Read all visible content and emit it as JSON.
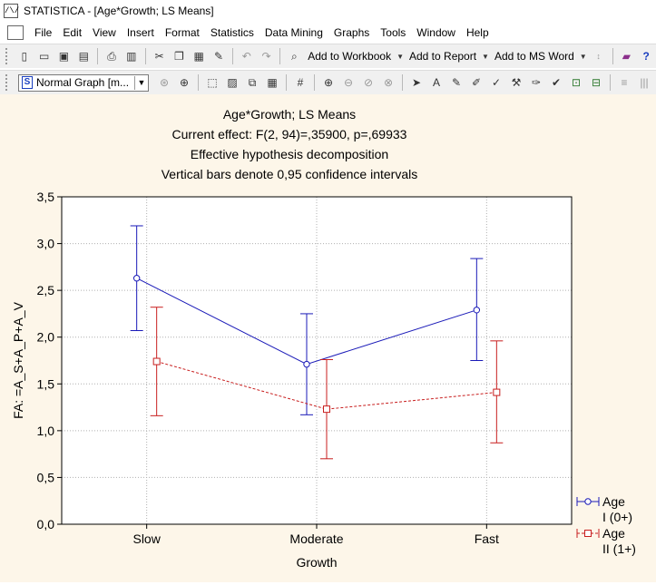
{
  "window": {
    "title": "STATISTICA - [Age*Growth; LS Means]"
  },
  "menu": [
    "File",
    "Edit",
    "View",
    "Insert",
    "Format",
    "Statistics",
    "Data Mining",
    "Graphs",
    "Tools",
    "Window",
    "Help"
  ],
  "toolbar1": {
    "add_workbook": "Add to Workbook",
    "add_report": "Add to Report",
    "add_word": "Add to MS Word"
  },
  "toolbar2": {
    "graph_style": "Normal Graph [m..."
  },
  "chart": {
    "title_lines": [
      "Age*Growth; LS Means",
      "Current effect: F(2, 94)=,35900, p=,69933",
      "Effective hypothesis decomposition",
      "Vertical bars denote 0,95 confidence intervals"
    ],
    "xlabel": "Growth",
    "ylabel": "FA: =A_S+A_P+A_V",
    "yticks": [
      "0,0",
      "0,5",
      "1,0",
      "1,5",
      "2,0",
      "2,5",
      "3,0",
      "3,5"
    ],
    "legend": [
      {
        "line1": "Age",
        "line2": "I (0+)"
      },
      {
        "line1": "Age",
        "line2": "II (1+)"
      }
    ]
  },
  "chart_data": {
    "type": "line",
    "categories": [
      "Slow",
      "Moderate",
      "Fast"
    ],
    "series": [
      {
        "name": "Age I (0+)",
        "color": "#1a1ab8",
        "marker": "circle",
        "line": "solid",
        "values": [
          2.63,
          1.71,
          2.29
        ],
        "lower": [
          2.07,
          1.17,
          1.75
        ],
        "upper": [
          3.19,
          2.25,
          2.84
        ]
      },
      {
        "name": "Age II (1+)",
        "color": "#c81e1e",
        "marker": "square",
        "line": "dashed",
        "values": [
          1.74,
          1.23,
          1.41
        ],
        "lower": [
          1.16,
          0.7,
          0.87
        ],
        "upper": [
          2.32,
          1.76,
          1.96
        ]
      }
    ],
    "ylim": [
      0,
      3.5
    ],
    "grid": true,
    "legend_position": "bottom-right"
  }
}
